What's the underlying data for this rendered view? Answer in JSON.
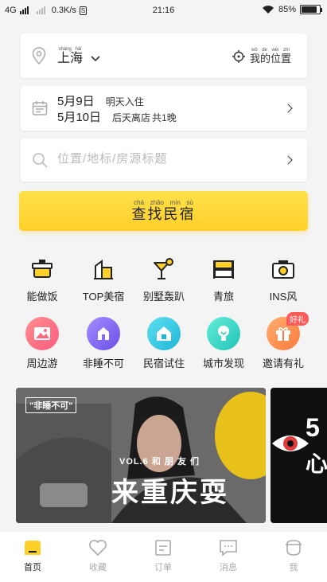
{
  "status": {
    "network": "4G",
    "speed": "0.3K/s",
    "time": "21:16",
    "battery": "85%",
    "battery_level": 0.85
  },
  "location": {
    "city": "上海",
    "city_pinyin": "shàng hǎi",
    "my_position": "我的位置",
    "my_position_pinyin": "wǒ de wèi zhì"
  },
  "dates": {
    "checkin": "5月9日",
    "checkin_tip": "明天入住",
    "checkout": "5月10日",
    "checkout_tip": "后天离店",
    "nights": "共1晚"
  },
  "search": {
    "placeholder": "位置/地标/房源标题"
  },
  "find_button": {
    "label": "查找民宿",
    "pinyin": "chá zhǎo mín sù"
  },
  "categories_row1": [
    {
      "label": "能做饭",
      "icon": "pot-icon"
    },
    {
      "label": "TOP美宿",
      "icon": "building-icon"
    },
    {
      "label": "别墅轰趴",
      "icon": "cocktail-icon"
    },
    {
      "label": "青旅",
      "icon": "bunkbed-icon"
    },
    {
      "label": "INS风",
      "icon": "camera-icon"
    }
  ],
  "categories_row2": [
    {
      "label": "周边游",
      "icon": "landscape-icon",
      "color": "#ff6b7d"
    },
    {
      "label": "非睡不可",
      "icon": "logo-n-icon",
      "color": "#7c64f4"
    },
    {
      "label": "民宿试住",
      "icon": "house-icon",
      "color": "#2ec7e0"
    },
    {
      "label": "城市发现",
      "icon": "bulb-icon",
      "color": "#34d4c4"
    },
    {
      "label": "邀请有礼",
      "icon": "gift-icon",
      "color": "#ff8a4c",
      "badge": "好礼"
    }
  ],
  "banner": {
    "tag": "\"非睡不可\"",
    "subtitle": "VOL.6 和 朋 友 们",
    "title": "来重庆耍",
    "side_text": "5",
    "side_text2": "心"
  },
  "tabs": [
    {
      "label": "首页",
      "icon": "home-icon",
      "active": true
    },
    {
      "label": "收藏",
      "icon": "heart-icon",
      "active": false
    },
    {
      "label": "订单",
      "icon": "order-icon",
      "active": false
    },
    {
      "label": "消息",
      "icon": "message-icon",
      "active": false
    },
    {
      "label": "我",
      "icon": "profile-icon",
      "active": false
    }
  ]
}
